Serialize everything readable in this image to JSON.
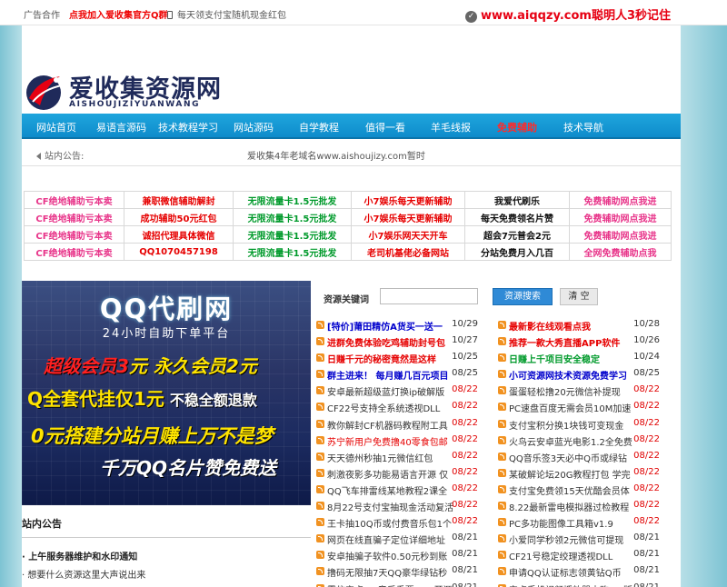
{
  "topbar": {
    "ad_link": "广告合作",
    "qq_group": "点我加入爱收集官方Q群",
    "daily": "每天领支付宝随机现金红包",
    "slogan": "www.aiqqzy.com聪明人3秒记住",
    "slogan_icon": "check-circle-icon"
  },
  "logo": {
    "cn": "爱收集资源网",
    "en": "AISHOUJIZIYUANWANG"
  },
  "nav": [
    "网站首页",
    "易语言源码",
    "技术教程学习",
    "网站源码",
    "自学教程",
    "值得一看",
    "羊毛线报",
    "免费辅助",
    "技术导航"
  ],
  "nav_hot_index": 7,
  "notice": {
    "label": "站内公告:",
    "text": "爱收集4年老域名www.aishoujizy.com暂时"
  },
  "ads": [
    [
      {
        "t": "CF绝地辅助亏本卖",
        "c": "#e8358a"
      },
      {
        "t": "兼职微信辅助解封",
        "c": "#e60000"
      },
      {
        "t": "无限流量卡1.5元批发",
        "c": "#009a2b"
      },
      {
        "t": "小7娱乐每天更新辅助",
        "c": "#e60000"
      },
      {
        "t": "我爱代刷乐",
        "c": "#111111"
      },
      {
        "t": "免费辅助网点我进",
        "c": "#e8358a"
      }
    ],
    [
      {
        "t": "CF绝地辅助亏本卖",
        "c": "#e8358a"
      },
      {
        "t": "成功辅助50元红包",
        "c": "#e60000"
      },
      {
        "t": "无限流量卡1.5元批发",
        "c": "#009a2b"
      },
      {
        "t": "小7娱乐每天更新辅助",
        "c": "#e60000"
      },
      {
        "t": "每天免费领名片赞",
        "c": "#111111"
      },
      {
        "t": "免费辅助网点我进",
        "c": "#e8358a"
      }
    ],
    [
      {
        "t": "CF绝地辅助亏本卖",
        "c": "#e8358a"
      },
      {
        "t": "诚招代理具体微信",
        "c": "#e60000"
      },
      {
        "t": "无限流量卡1.5元批发",
        "c": "#009a2b"
      },
      {
        "t": "小7娱乐网天天开车",
        "c": "#e60000"
      },
      {
        "t": "超会7元普会2元",
        "c": "#111111"
      },
      {
        "t": "免费辅助网点我进",
        "c": "#e8358a"
      }
    ],
    [
      {
        "t": "CF绝地辅助亏本卖",
        "c": "#e8358a"
      },
      {
        "t": "QQ1070457198",
        "c": "#e60000"
      },
      {
        "t": "无限流量卡1.5元批发",
        "c": "#009a2b"
      },
      {
        "t": "老司机基佬必备网站",
        "c": "#e60000"
      },
      {
        "t": "分站免费月入几百",
        "c": "#111111"
      },
      {
        "t": "全网免费辅助点我",
        "c": "#e8358a"
      }
    ]
  ],
  "banner": {
    "title": "QQ代刷网",
    "subtitle": "24小时自助下单平台",
    "line1_a": "超级会员",
    "line1_b": "3",
    "line1_c": "元  永久会员2元",
    "line2_a": "Q全套代挂仅1元",
    "line2_b": "不稳全额退款",
    "line3": "0元搭建分站月赚上万不是梦",
    "line4": "千万QQ名片赞免费送"
  },
  "side": {
    "title": "站内公告",
    "item1": "· 上午服务器维护和水印通知",
    "item2": "· 想要什么资源这里大声说出来"
  },
  "search": {
    "label": "资源关键词",
    "value": "",
    "button": "资源搜索",
    "clear": "清 空"
  },
  "col1": [
    {
      "t": "[特价]莆田精仿A货买一送一",
      "d": "10/29",
      "c": "#0000cc",
      "b": true,
      "r": false
    },
    {
      "t": "进群免费体验吃鸡辅助封号包",
      "d": "10/27",
      "c": "#e60000",
      "b": true,
      "r": false
    },
    {
      "t": "日赚千元的秘密竟然是这样",
      "d": "10/25",
      "c": "#e60000",
      "b": true,
      "r": false
    },
    {
      "t": "群主进来！ 每月赚几百元项目",
      "d": "08/25",
      "c": "#0000cc",
      "b": true,
      "r": false
    },
    {
      "t": "安卓最新超级蓝灯换ip破解版",
      "d": "08/22",
      "c": "#333333",
      "b": false,
      "r": true
    },
    {
      "t": "CF22号支持全系统透视DLL",
      "d": "08/22",
      "c": "#333333",
      "b": false,
      "r": true
    },
    {
      "t": "教你解封CF机器码教程附工具",
      "d": "08/22",
      "c": "#333333",
      "b": false,
      "r": true
    },
    {
      "t": "苏宁新用户免费撸40零食包邮",
      "d": "08/22",
      "c": "#e60000",
      "b": false,
      "r": true
    },
    {
      "t": "天天德州秒抽1元微信红包",
      "d": "08/22",
      "c": "#333333",
      "b": false,
      "r": true
    },
    {
      "t": "刺激夜影多功能易语言开源 仅",
      "d": "08/22",
      "c": "#333333",
      "b": false,
      "r": true
    },
    {
      "t": "QQ飞车排雷线某地教程2课全",
      "d": "08/22",
      "c": "#333333",
      "b": false,
      "r": true
    },
    {
      "t": "8月22号支付宝抽现金活动复活",
      "d": "08/22",
      "c": "#333333",
      "b": false,
      "r": true
    },
    {
      "t": "王卡抽10Q币或付费音乐包1个",
      "d": "08/22",
      "c": "#333333",
      "b": false,
      "r": true
    },
    {
      "t": "网页在线直骗子定位详细地址",
      "d": "08/21",
      "c": "#333333",
      "b": false,
      "r": false
    },
    {
      "t": "安卓抽骗子软件0.50元秒到账",
      "d": "08/21",
      "c": "#333333",
      "b": false,
      "r": false
    },
    {
      "t": "撸码无限抽7天QQ豪华绿钻秒",
      "d": "08/21",
      "c": "#333333",
      "b": false,
      "r": false
    },
    {
      "t": "霸信安卓QQ音乐重要IAPP开源",
      "d": "08/21",
      "c": "#333333",
      "b": false,
      "r": false
    }
  ],
  "col2": [
    {
      "t": "最新影在线观看点我",
      "d": "10/28",
      "c": "#e60000",
      "b": true,
      "r": false
    },
    {
      "t": "推荐一款大秀直播APP软件",
      "d": "10/26",
      "c": "#e60000",
      "b": true,
      "r": false
    },
    {
      "t": "日赚上千项目安全稳定",
      "d": "10/24",
      "c": "#009a2b",
      "b": true,
      "r": false
    },
    {
      "t": "小可资源网技术资源免费学习",
      "d": "08/25",
      "c": "#0000cc",
      "b": true,
      "r": false
    },
    {
      "t": "蛋蛋轻松撸20元微信补提现",
      "d": "08/22",
      "c": "#333333",
      "b": false,
      "r": true
    },
    {
      "t": "PC速盘百度无需会员10M加速",
      "d": "08/22",
      "c": "#333333",
      "b": false,
      "r": true
    },
    {
      "t": "支付宝积分换1块钱可变现金",
      "d": "08/22",
      "c": "#333333",
      "b": false,
      "r": true
    },
    {
      "t": "火鸟云安卓蓝光电影1.2全免费",
      "d": "08/22",
      "c": "#333333",
      "b": false,
      "r": true
    },
    {
      "t": "QQ音乐签3天必中Q币或绿钻",
      "d": "08/22",
      "c": "#333333",
      "b": false,
      "r": true
    },
    {
      "t": "某破解论坛20G教程打包 学完",
      "d": "08/22",
      "c": "#333333",
      "b": false,
      "r": true
    },
    {
      "t": "支付宝免费领15天优酷会员体",
      "d": "08/22",
      "c": "#333333",
      "b": false,
      "r": true
    },
    {
      "t": "8.22最新雷电模拟器过检教程",
      "d": "08/22",
      "c": "#333333",
      "b": false,
      "r": true
    },
    {
      "t": "PC多功能图像工具箱v1.9",
      "d": "08/22",
      "c": "#333333",
      "b": false,
      "r": true
    },
    {
      "t": "小爱同学秒领2元微信可提现",
      "d": "08/21",
      "c": "#333333",
      "b": false,
      "r": false
    },
    {
      "t": "CF21号稳定绞理透视DLL",
      "d": "08/21",
      "c": "#333333",
      "b": false,
      "r": false
    },
    {
      "t": "申请QQ认证标志领黄钻Q币",
      "d": "08/21",
      "c": "#333333",
      "b": false,
      "r": false
    },
    {
      "t": "安卓手机视频播放器内购VIP版",
      "d": "08/21",
      "c": "#333333",
      "b": false,
      "r": false
    }
  ]
}
